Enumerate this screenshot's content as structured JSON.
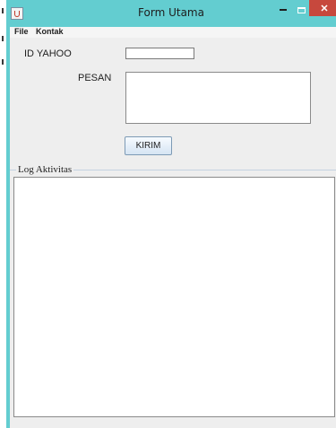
{
  "window": {
    "title": "Form Utama",
    "close_glyph": "✕",
    "icons": {
      "app": "java-cup-icon",
      "minimize": "minimize-icon",
      "maximize": "maximize-icon",
      "close": "close-icon"
    }
  },
  "menu": {
    "items": [
      "File",
      "Kontak"
    ]
  },
  "form": {
    "id_label": "ID YAHOO",
    "id_value": "",
    "pesan_label": "PESAN",
    "pesan_value": "",
    "send_label": "KIRIM"
  },
  "log": {
    "title": "Log Aktivitas",
    "content": ""
  },
  "colors": {
    "title_bar": "#63cdd0",
    "close_button": "#c7483d",
    "client_bg": "#eeeeee",
    "button_border": "#7d9ab5"
  }
}
